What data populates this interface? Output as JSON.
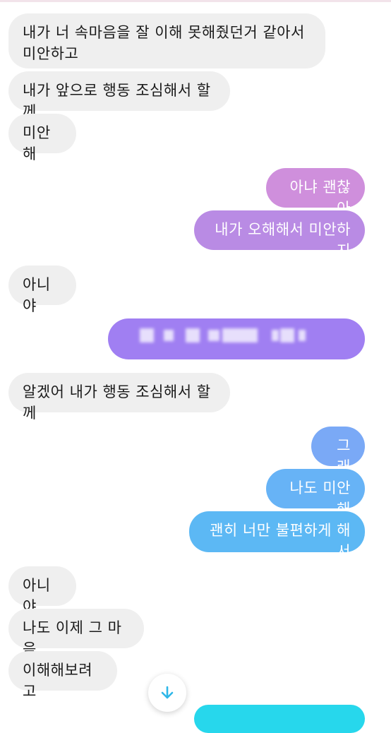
{
  "messages": {
    "m1": "내가 너 속마음을 잘 이해 못해줬던거 같아서\n미안하고",
    "m2": "내가 앞으로 행동 조심해서 할께",
    "m3": "미안해",
    "m4": "아냐 괜찮아",
    "m5": "내가 오해해서 미안하지",
    "m6": "아니야",
    "m7": "알겠어 내가 행동 조심해서 할께",
    "m8": "그래",
    "m9": "나도 미안해",
    "m10": "괜히 너만 불편하게 해서",
    "m11": "아니야",
    "m12": "나도 이제 그 마음",
    "m13": "이해해보려고"
  },
  "colors": {
    "received_bubble": "#efefef",
    "sent_purple": "#b98be4",
    "sent_blue": "#67b3f6",
    "sent_cyan": "#27d7ec"
  },
  "icons": {
    "scroll_down": "arrow-down-icon"
  }
}
